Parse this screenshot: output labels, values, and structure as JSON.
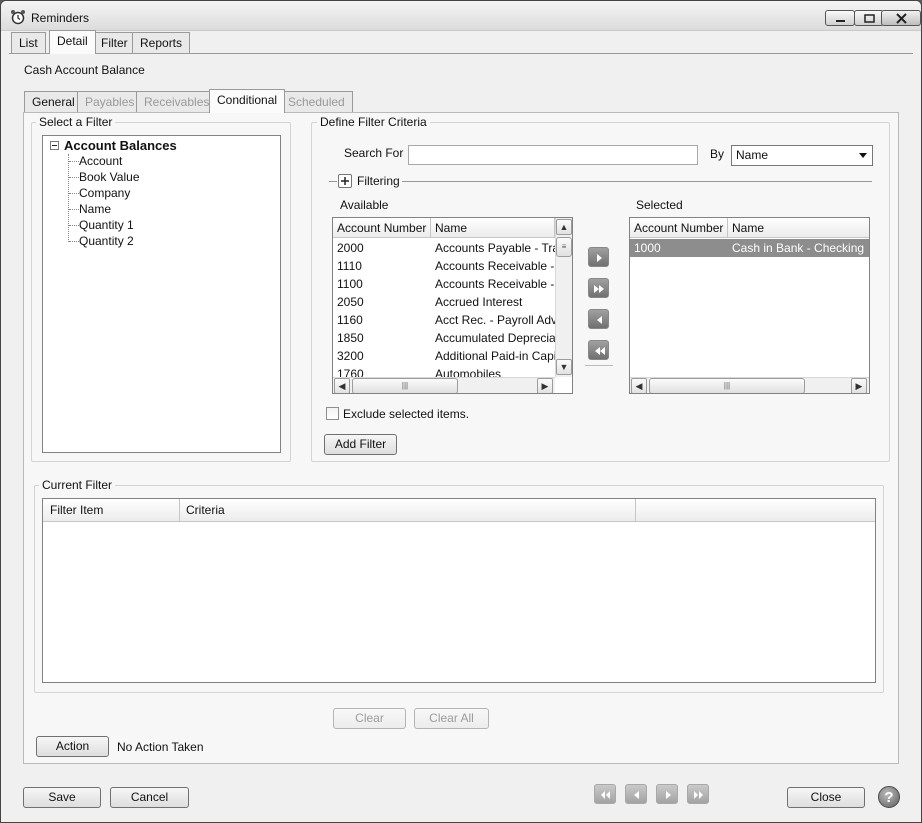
{
  "window": {
    "title": "Reminders"
  },
  "main_tabs": [
    "List",
    "Detail",
    "Filter",
    "Reports"
  ],
  "record_title": "Cash Account Balance",
  "sub_tabs": [
    "General",
    "Payables",
    "Receivables",
    "Conditional",
    "Scheduled"
  ],
  "select_filter": {
    "legend": "Select a Filter",
    "root": "Account Balances",
    "children": [
      "Account",
      "Book Value",
      "Company",
      "Name",
      "Quantity 1",
      "Quantity 2"
    ]
  },
  "define_criteria": {
    "legend": "Define Filter Criteria",
    "search_label": "Search For",
    "search_value": "",
    "by_label": "By",
    "by_value": "Name",
    "filtering_label": "Filtering",
    "available_label": "Available",
    "selected_label": "Selected",
    "columns": [
      "Account Number",
      "Name"
    ],
    "available_rows": [
      [
        "2000",
        "Accounts Payable - Trade"
      ],
      [
        "1110",
        "Accounts Receivable - Bu"
      ],
      [
        "1100",
        "Accounts Receivable - Re"
      ],
      [
        "2050",
        "Accrued Interest"
      ],
      [
        "1160",
        "Acct Rec. - Payroll Advan"
      ],
      [
        "1850",
        "Accumulated Depreciation"
      ],
      [
        "3200",
        "Additional Paid-in Capital"
      ],
      [
        "1760",
        "Automobiles"
      ]
    ],
    "selected_rows": [
      [
        "1000",
        "Cash in Bank - Checking"
      ]
    ],
    "exclude_label": "Exclude selected items.",
    "add_filter_label": "Add Filter"
  },
  "current_filter": {
    "legend": "Current Filter",
    "columns": [
      "Filter Item",
      "Criteria"
    ],
    "clear_label": "Clear",
    "clear_all_label": "Clear All"
  },
  "action": {
    "button_label": "Action",
    "status": "No Action Taken"
  },
  "footer": {
    "save_label": "Save",
    "cancel_label": "Cancel",
    "close_label": "Close",
    "help_label": "?"
  }
}
